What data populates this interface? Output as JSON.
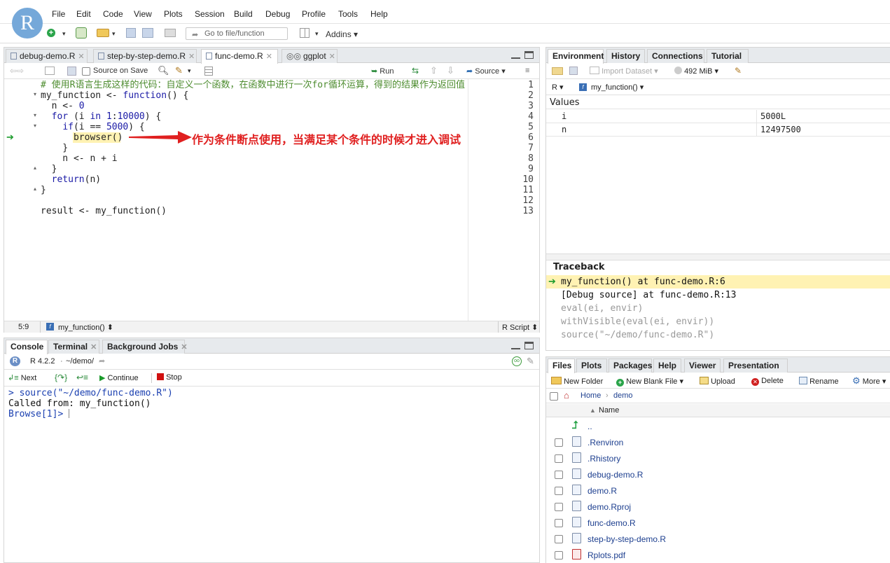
{
  "menu": [
    "File",
    "Edit",
    "Code",
    "View",
    "Plots",
    "Session",
    "Build",
    "Debug",
    "Profile",
    "Tools",
    "Help"
  ],
  "logo_letter": "R",
  "toolbar": {
    "goto_placeholder": "Go to file/function",
    "addins": "Addins"
  },
  "editor": {
    "tabs": [
      {
        "label": "debug-demo.R",
        "active": false
      },
      {
        "label": "step-by-step-demo.R",
        "active": false
      },
      {
        "label": "func-demo.R",
        "active": true
      },
      {
        "label": "ggplot",
        "active": false
      }
    ],
    "source_on_save": "Source on Save",
    "run_label": "Run",
    "source_label": "Source",
    "line_numbers": [
      "1",
      "2",
      "3",
      "4",
      "5",
      "6",
      "7",
      "8",
      "9",
      "10",
      "11",
      "12",
      "13"
    ],
    "lines": [
      "# 使用R语言生成这样的代码：自定义一个函数，在函数中进行一次for循环运算，得到的结果作为返回值",
      "my_function <- function() {",
      "  n <- 0",
      "  for (i in 1:10000) {",
      "    if(i == 5000) {",
      "      browser()",
      "    }",
      "    n <- n + i",
      "  }",
      "  return(n)",
      "}",
      "",
      "result <- my_function()"
    ],
    "annotation": "作为条件断点使用，当满足某个条件的时候才进入调试",
    "status_position": "5:9",
    "status_function": "my_function()",
    "status_filetype": "R Script"
  },
  "console": {
    "tabs": [
      "Console",
      "Terminal",
      "Background Jobs"
    ],
    "r_version": "R 4.2.2",
    "path": "~/demo/",
    "debug_buttons": {
      "next": "Next",
      "continue": "Continue",
      "stop": "Stop"
    },
    "lines": [
      "> source(\"~/demo/func-demo.R\")",
      "Called from: my_function()",
      "Browse[1]> "
    ]
  },
  "environment": {
    "tabs": [
      "Environment",
      "History",
      "Connections",
      "Tutorial"
    ],
    "import_dataset": "Import Dataset",
    "memory": "492 MiB",
    "lang": "R",
    "scope": "my_function()",
    "section_label": "Values",
    "values": [
      {
        "name": "i",
        "value": "5000L"
      },
      {
        "name": "n",
        "value": "12497500"
      }
    ],
    "traceback_label": "Traceback",
    "traceback": [
      "my_function() at func-demo.R:6",
      "[Debug source] at func-demo.R:13",
      "eval(ei, envir)",
      "withVisible(eval(ei, envir))",
      "source(\"~/demo/func-demo.R\")"
    ]
  },
  "files": {
    "tabs": [
      "Files",
      "Plots",
      "Packages",
      "Help",
      "Viewer",
      "Presentation"
    ],
    "buttons": {
      "new_folder": "New Folder",
      "new_blank_file": "New Blank File",
      "upload": "Upload",
      "delete": "Delete",
      "rename": "Rename",
      "more": "More"
    },
    "breadcrumb": [
      "Home",
      "demo"
    ],
    "column_name": "Name",
    "up_label": "..",
    "items": [
      ".Renviron",
      ".Rhistory",
      "debug-demo.R",
      "demo.R",
      "demo.Rproj",
      "func-demo.R",
      "step-by-step-demo.R",
      "Rplots.pdf"
    ]
  },
  "colors": {
    "accent": "#75a8d9",
    "arrow": "#e02020",
    "traceback_highlight": "#fff2b3",
    "link": "#1d3f8f"
  }
}
